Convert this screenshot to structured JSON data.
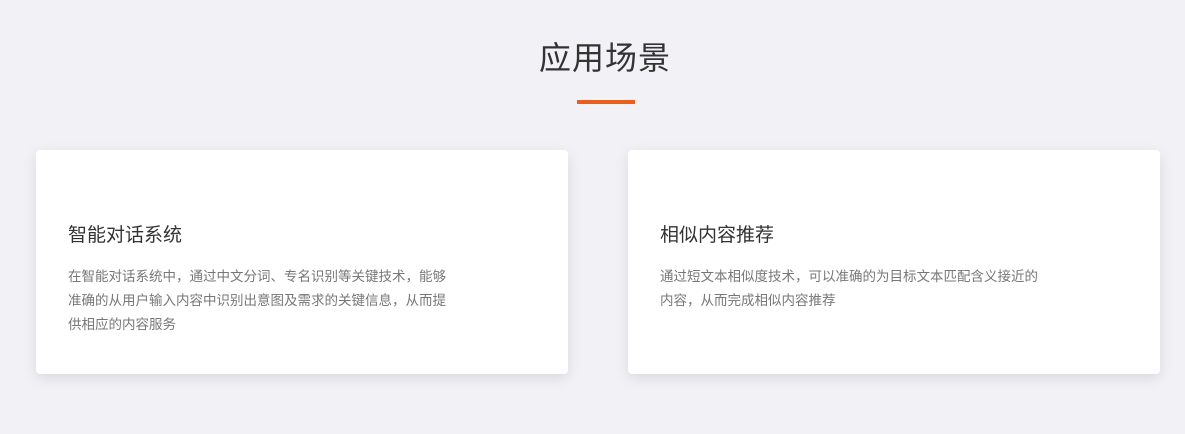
{
  "section": {
    "title": "应用场景",
    "accent_color": "#ea5f1d"
  },
  "cards": [
    {
      "title": "智能对话系统",
      "lines": [
        "在智能对话系统中，通过中文分词、专名识别等关键技术，能够",
        "准确的从用户输入内容中识别出意图及需求的关键信息，从而提",
        "供相应的内容服务"
      ]
    },
    {
      "title": "相似内容推荐",
      "lines": [
        "通过短文本相似度技术，可以准确的为目标文本匹配含义接近的",
        "内容，从而完成相似内容推荐"
      ]
    }
  ]
}
